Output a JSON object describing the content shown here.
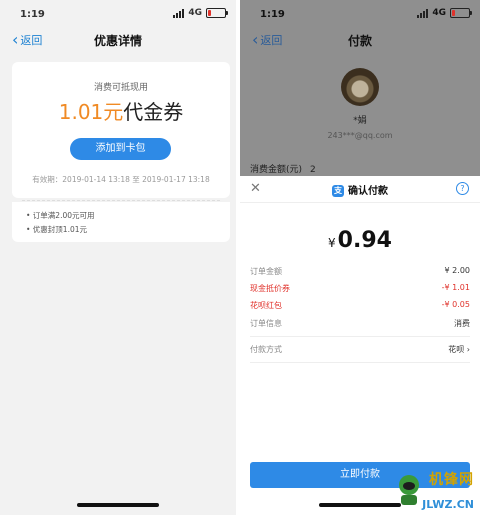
{
  "left": {
    "status": {
      "time": "1:19",
      "network": "4G"
    },
    "nav": {
      "back": "返回",
      "title": "优惠详情"
    },
    "coupon": {
      "subtitle": "消费可抵现用",
      "amount_number": "1.01元",
      "amount_label": "代金券",
      "button": "添加到卡包",
      "validity": "有效期：2019-01-14 13:18 至 2019-01-17 13:18"
    },
    "rules": [
      "• 订单满2.00元可用",
      "• 优惠封顶1.01元"
    ]
  },
  "right": {
    "status": {
      "time": "1:19",
      "network": "4G"
    },
    "nav": {
      "back": "返回",
      "title": "付款"
    },
    "payee": {
      "name": "*娟",
      "email": "243***@qq.com"
    },
    "amount_row": {
      "label": "消费金额(元)",
      "value": "2"
    },
    "sheet": {
      "title": "确认付款",
      "logo": "支",
      "currency": "¥",
      "amount": "0.94",
      "rows": [
        {
          "label": "订单金额",
          "value": "¥ 2.00"
        },
        {
          "label": "现金抵价券",
          "value": "-¥ 1.01"
        },
        {
          "label": "花呗红包",
          "value": "-¥ 0.05"
        },
        {
          "label": "订单信息",
          "value": "消费"
        }
      ],
      "pay_method": {
        "label": "付款方式",
        "value": "花呗 ›"
      },
      "pay_button": "立即付款"
    }
  },
  "watermark": {
    "text": "机锋网",
    "url": "JLWZ.CN"
  },
  "colors": {
    "accent": "#2e8ae6",
    "coupon_orange": "#f08a24",
    "discount_red": "#e0322b"
  }
}
